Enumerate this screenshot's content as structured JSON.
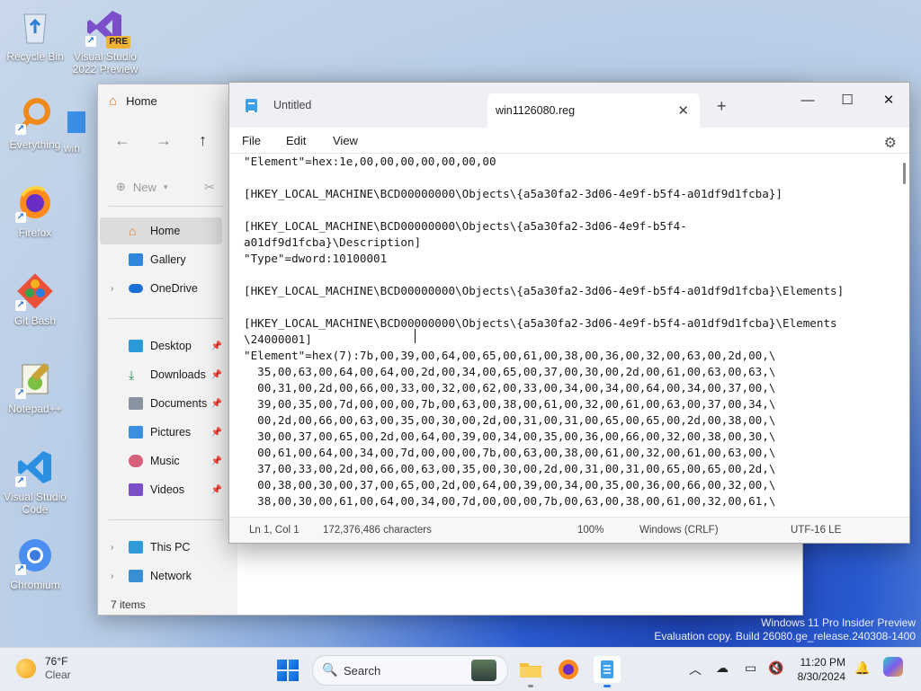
{
  "desktop": {
    "icons": [
      {
        "label": "Recycle Bin",
        "icon": "recycle-bin-icon"
      },
      {
        "label": "Visual Studio 2022 Preview",
        "badge": "PRE",
        "icon": "visual-studio-preview-icon"
      },
      {
        "label": "Everything",
        "icon": "everything-search-icon"
      },
      {
        "label": "win",
        "icon": "win-shortcut-icon"
      },
      {
        "label": "Firefox",
        "icon": "firefox-icon"
      },
      {
        "label": "Git Bash",
        "icon": "git-bash-icon"
      },
      {
        "label": "Notepad++",
        "icon": "notepadplusplus-icon"
      },
      {
        "label": "Visual Studio Code",
        "icon": "vscode-icon"
      },
      {
        "label": "Chromium",
        "icon": "chromium-icon"
      }
    ],
    "watermark": {
      "line1": "Windows 11 Pro Insider Preview",
      "line2": "Evaluation copy. Build 26080.ge_release.240308-1400"
    }
  },
  "explorer": {
    "tab_title": "Home",
    "toolbar": {
      "new_label": "New"
    },
    "nav": [
      {
        "label": "Home",
        "selected": true,
        "icon": "home-icon"
      },
      {
        "label": "Gallery",
        "icon": "gallery-icon"
      },
      {
        "label": "OneDrive",
        "expandable": true,
        "icon": "cloud-icon"
      },
      {
        "label": "Desktop",
        "pinned": true,
        "icon": "desktop-folder-icon"
      },
      {
        "label": "Downloads",
        "pinned": true,
        "icon": "download-icon"
      },
      {
        "label": "Documents",
        "pinned": true,
        "icon": "documents-icon"
      },
      {
        "label": "Pictures",
        "pinned": true,
        "icon": "pictures-icon"
      },
      {
        "label": "Music",
        "pinned": true,
        "icon": "music-icon"
      },
      {
        "label": "Videos",
        "pinned": true,
        "icon": "videos-icon"
      },
      {
        "label": "This PC",
        "expandable": true,
        "icon": "this-pc-icon"
      },
      {
        "label": "Network",
        "expandable": true,
        "icon": "network-icon"
      }
    ],
    "status": "7 items"
  },
  "notepad": {
    "tabs": [
      {
        "label": "Untitled",
        "active": false
      },
      {
        "label": "win1126080.reg",
        "active": true
      }
    ],
    "menu": {
      "file": "File",
      "edit": "Edit",
      "view": "View"
    },
    "content_lines": [
      "\"Element\"=hex:1e,00,00,00,00,00,00,00",
      "",
      "[HKEY_LOCAL_MACHINE\\BCD00000000\\Objects\\{a5a30fa2-3d06-4e9f-b5f4-a01df9d1fcba}]",
      "",
      "[HKEY_LOCAL_MACHINE\\BCD00000000\\Objects\\{a5a30fa2-3d06-4e9f-b5f4-",
      "a01df9d1fcba}\\Description]",
      "\"Type\"=dword:10100001",
      "",
      "[HKEY_LOCAL_MACHINE\\BCD00000000\\Objects\\{a5a30fa2-3d06-4e9f-b5f4-a01df9d1fcba}\\Elements]",
      "",
      "[HKEY_LOCAL_MACHINE\\BCD00000000\\Objects\\{a5a30fa2-3d06-4e9f-b5f4-a01df9d1fcba}\\Elements",
      "\\24000001]",
      "\"Element\"=hex(7):7b,00,39,00,64,00,65,00,61,00,38,00,36,00,32,00,63,00,2d,00,\\",
      "  35,00,63,00,64,00,64,00,2d,00,34,00,65,00,37,00,30,00,2d,00,61,00,63,00,63,\\",
      "  00,31,00,2d,00,66,00,33,00,32,00,62,00,33,00,34,00,34,00,64,00,34,00,37,00,\\",
      "  39,00,35,00,7d,00,00,00,7b,00,63,00,38,00,61,00,32,00,61,00,63,00,37,00,34,\\",
      "  00,2d,00,66,00,63,00,35,00,30,00,2d,00,31,00,31,00,65,00,65,00,2d,00,38,00,\\",
      "  30,00,37,00,65,00,2d,00,64,00,39,00,34,00,35,00,36,00,66,00,32,00,38,00,30,\\",
      "  00,61,00,64,00,34,00,7d,00,00,00,7b,00,63,00,38,00,61,00,32,00,61,00,63,00,\\",
      "  37,00,33,00,2d,00,66,00,63,00,35,00,30,00,2d,00,31,00,31,00,65,00,65,00,2d,\\",
      "  00,38,00,30,00,37,00,65,00,2d,00,64,00,39,00,34,00,35,00,36,00,66,00,32,00,\\",
      "  38,00,30,00,61,00,64,00,34,00,7d,00,00,00,7b,00,63,00,38,00,61,00,32,00,61,\\"
    ],
    "status": {
      "position": "Ln 1, Col 1",
      "characters": "172,376,486 characters",
      "zoom": "100%",
      "line_ending": "Windows (CRLF)",
      "encoding": "UTF-16 LE"
    }
  },
  "taskbar": {
    "weather": {
      "temp": "76°F",
      "condition": "Clear"
    },
    "search_label": "Search",
    "time": "11:20 PM",
    "date": "8/30/2024"
  },
  "colors": {
    "accent": "#2d7be0",
    "notepad_icon": "#3da0e8"
  }
}
